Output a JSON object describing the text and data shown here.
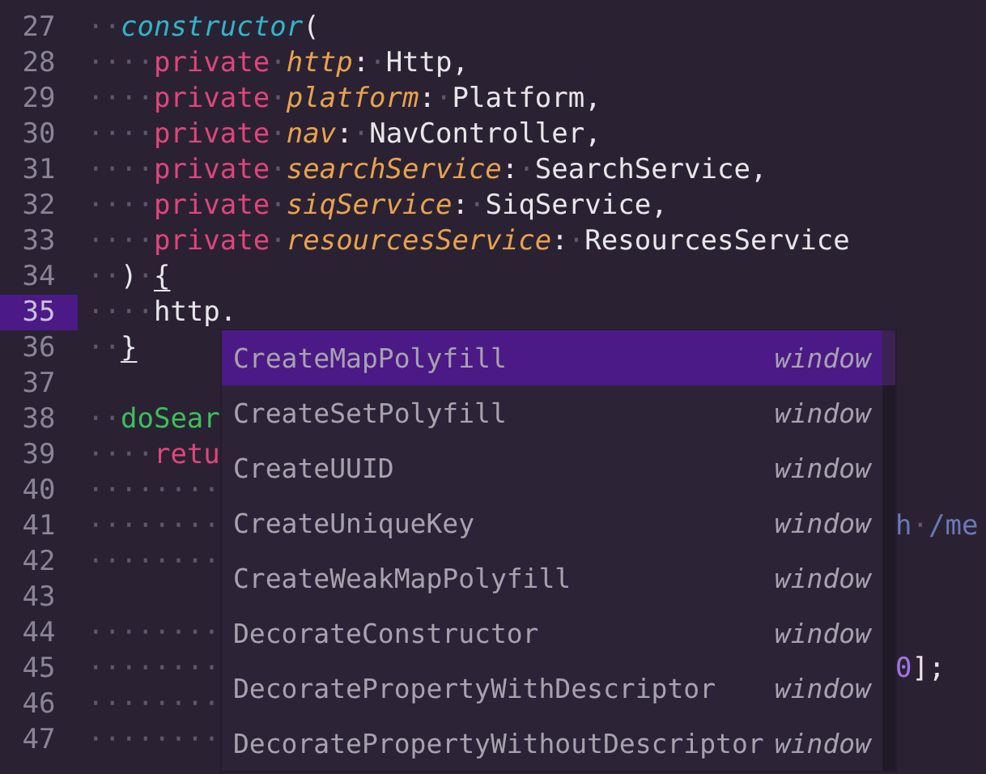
{
  "editor": {
    "lines": [
      {
        "number": "27",
        "current": false,
        "tokens": [
          {
            "kind": "ws",
            "text": "··"
          },
          {
            "kind": "function",
            "text": "constructor"
          },
          {
            "kind": "plain",
            "text": "("
          }
        ]
      },
      {
        "number": "28",
        "current": false,
        "tokens": [
          {
            "kind": "ws",
            "text": "····"
          },
          {
            "kind": "keyword",
            "text": "private"
          },
          {
            "kind": "ws",
            "text": "·"
          },
          {
            "kind": "param",
            "text": "http"
          },
          {
            "kind": "plain",
            "text": ":"
          },
          {
            "kind": "ws",
            "text": "·"
          },
          {
            "kind": "plain",
            "text": "Http,"
          }
        ]
      },
      {
        "number": "29",
        "current": false,
        "tokens": [
          {
            "kind": "ws",
            "text": "····"
          },
          {
            "kind": "keyword",
            "text": "private"
          },
          {
            "kind": "ws",
            "text": "·"
          },
          {
            "kind": "param",
            "text": "platform"
          },
          {
            "kind": "plain",
            "text": ":"
          },
          {
            "kind": "ws",
            "text": "·"
          },
          {
            "kind": "plain",
            "text": "Platform,"
          }
        ]
      },
      {
        "number": "30",
        "current": false,
        "tokens": [
          {
            "kind": "ws",
            "text": "····"
          },
          {
            "kind": "keyword",
            "text": "private"
          },
          {
            "kind": "ws",
            "text": "·"
          },
          {
            "kind": "param",
            "text": "nav"
          },
          {
            "kind": "plain",
            "text": ":"
          },
          {
            "kind": "ws",
            "text": "·"
          },
          {
            "kind": "plain",
            "text": "NavController,"
          }
        ]
      },
      {
        "number": "31",
        "current": false,
        "tokens": [
          {
            "kind": "ws",
            "text": "····"
          },
          {
            "kind": "keyword",
            "text": "private"
          },
          {
            "kind": "ws",
            "text": "·"
          },
          {
            "kind": "param",
            "text": "searchService"
          },
          {
            "kind": "plain",
            "text": ":"
          },
          {
            "kind": "ws",
            "text": "·"
          },
          {
            "kind": "plain",
            "text": "SearchService,"
          }
        ]
      },
      {
        "number": "32",
        "current": false,
        "tokens": [
          {
            "kind": "ws",
            "text": "····"
          },
          {
            "kind": "keyword",
            "text": "private"
          },
          {
            "kind": "ws",
            "text": "·"
          },
          {
            "kind": "param",
            "text": "siqService"
          },
          {
            "kind": "plain",
            "text": ":"
          },
          {
            "kind": "ws",
            "text": "·"
          },
          {
            "kind": "plain",
            "text": "SiqService,"
          }
        ]
      },
      {
        "number": "33",
        "current": false,
        "tokens": [
          {
            "kind": "ws",
            "text": "····"
          },
          {
            "kind": "keyword",
            "text": "private"
          },
          {
            "kind": "ws",
            "text": "·"
          },
          {
            "kind": "param",
            "text": "resourcesService"
          },
          {
            "kind": "plain",
            "text": ":"
          },
          {
            "kind": "ws",
            "text": "·"
          },
          {
            "kind": "plain",
            "text": "ResourcesService"
          }
        ]
      },
      {
        "number": "34",
        "current": false,
        "tokens": [
          {
            "kind": "ws",
            "text": "··"
          },
          {
            "kind": "plain",
            "text": ")"
          },
          {
            "kind": "ws",
            "text": "·"
          },
          {
            "kind": "bracket",
            "text": "{"
          }
        ]
      },
      {
        "number": "35",
        "current": true,
        "tokens": [
          {
            "kind": "ws",
            "text": "····"
          },
          {
            "kind": "plain",
            "text": "http."
          }
        ]
      },
      {
        "number": "36",
        "current": false,
        "tokens": [
          {
            "kind": "ws",
            "text": "··"
          },
          {
            "kind": "bracket",
            "text": "}"
          }
        ]
      },
      {
        "number": "37",
        "current": false
      },
      {
        "number": "38",
        "current": false,
        "tokens": [
          {
            "kind": "ws",
            "text": "··"
          },
          {
            "kind": "method",
            "text": "doSear"
          }
        ]
      },
      {
        "number": "39",
        "current": false,
        "tokens": [
          {
            "kind": "ws",
            "text": "····"
          },
          {
            "kind": "keyword",
            "text": "retu"
          }
        ]
      },
      {
        "number": "40",
        "current": false,
        "tokens": [
          {
            "kind": "ws",
            "text": "········"
          }
        ]
      },
      {
        "number": "41",
        "current": false,
        "tokens": [
          {
            "kind": "ws",
            "text": "········"
          }
        ],
        "right": [
          {
            "kind": "string",
            "text": "h"
          },
          {
            "kind": "ws",
            "text": "·"
          },
          {
            "kind": "string",
            "text": "/me"
          }
        ]
      },
      {
        "number": "42",
        "current": false,
        "tokens": [
          {
            "kind": "ws",
            "text": "········"
          }
        ]
      },
      {
        "number": "43",
        "current": false
      },
      {
        "number": "44",
        "current": false,
        "tokens": [
          {
            "kind": "ws",
            "text": "········"
          }
        ]
      },
      {
        "number": "45",
        "current": false,
        "tokens": [
          {
            "kind": "ws",
            "text": "········"
          }
        ],
        "right": [
          {
            "kind": "number",
            "text": "0"
          },
          {
            "kind": "plain",
            "text": "];"
          }
        ]
      },
      {
        "number": "46",
        "current": false,
        "tokens": [
          {
            "kind": "ws",
            "text": "········"
          }
        ]
      },
      {
        "number": "47",
        "current": false,
        "tokens": [
          {
            "kind": "ws",
            "text": "········"
          }
        ]
      }
    ]
  },
  "suggestions": [
    {
      "label": "CreateMapPolyfill",
      "detail": "window",
      "selected": true
    },
    {
      "label": "CreateSetPolyfill",
      "detail": "window",
      "selected": false
    },
    {
      "label": "CreateUUID",
      "detail": "window",
      "selected": false
    },
    {
      "label": "CreateUniqueKey",
      "detail": "window",
      "selected": false
    },
    {
      "label": "CreateWeakMapPolyfill",
      "detail": "window",
      "selected": false
    },
    {
      "label": "DecorateConstructor",
      "detail": "window",
      "selected": false
    },
    {
      "label": "DecoratePropertyWithDescriptor",
      "detail": "window",
      "selected": false
    },
    {
      "label": "DecoratePropertyWithoutDescriptor",
      "detail": "window",
      "selected": false
    }
  ]
}
